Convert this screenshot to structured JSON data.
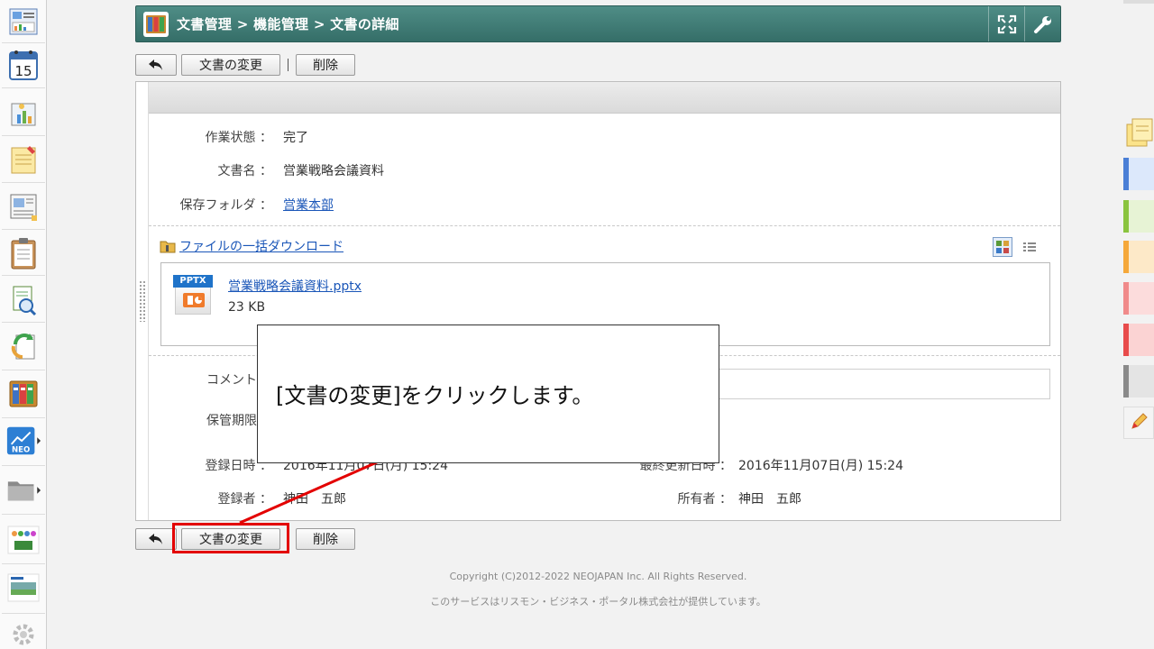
{
  "header": {
    "breadcrumb": "文書管理 > 機能管理 > 文書の詳細",
    "accent": "#3f7d77"
  },
  "toolbar_top": {
    "back_icon": "back-arrow-icon",
    "change_label": "文書の変更",
    "separator": "|",
    "delete_label": "削除"
  },
  "details": {
    "status_label": "作業状態 ：",
    "status_value": "完了",
    "name_label": "文書名 ：",
    "name_value": "営業戦略会議資料",
    "folder_label": "保存フォルダ ：",
    "folder_value": "営業本部",
    "bulk_download": "ファイルの一括ダウンロード",
    "file_name": "営業戦略会議資料.pptx",
    "file_badge": "PPTX",
    "file_size": "23 KB",
    "comment_label": "コメント",
    "retention_label": "保管期限",
    "created_label": "登録日時 ：",
    "created_value": "2016年11月07日(月) 15:24",
    "updated_label": "最終更新日時 ：",
    "updated_value": "2016年11月07日(月) 15:24",
    "creator_label": "登録者 ：",
    "creator_value": "神田　五郎",
    "owner_label": "所有者 ：",
    "owner_value": "神田　五郎"
  },
  "toolbar_bottom": {
    "change_label": "文書の変更",
    "delete_label": "削除"
  },
  "callout": {
    "text": "[文書の変更]をクリックします。"
  },
  "footer": {
    "copyright": "Copyright (C)2012-2022 NEOJAPAN Inc. All Rights Reserved.",
    "provider": "このサービスはリスモン・ビジネス・ポータル株式会社が提供しています。"
  },
  "sidebar": {
    "calendar_day": "15",
    "neo_label": "NEO"
  },
  "palette_colors": [
    "#4a7fd6",
    "#8ac43f",
    "#f5a83a",
    "#f08a8a",
    "#e84b4b",
    "#8a8a8a"
  ]
}
